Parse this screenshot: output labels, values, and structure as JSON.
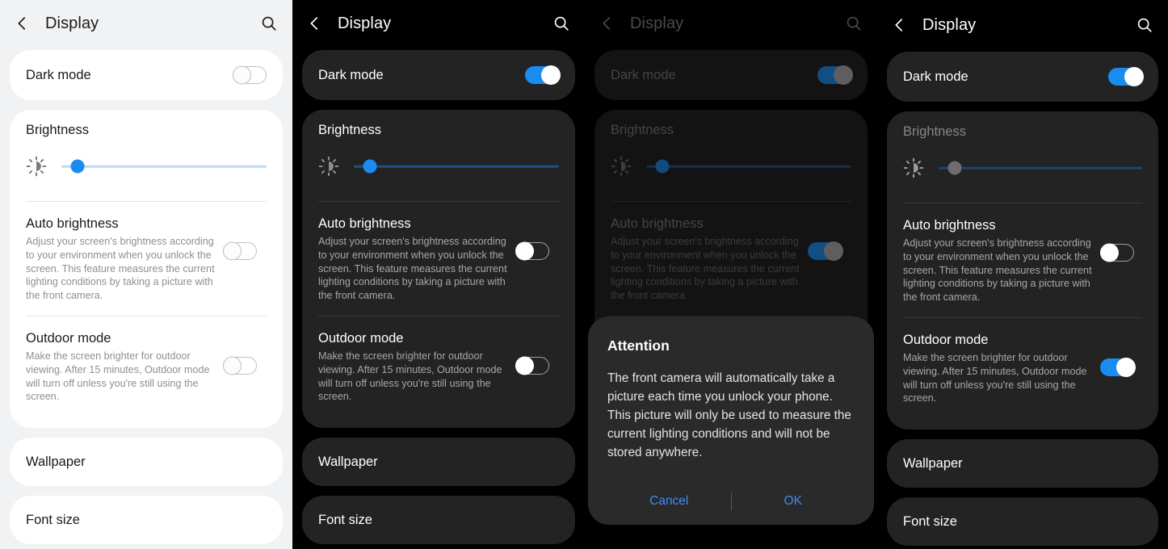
{
  "header": {
    "title": "Display",
    "back_icon": "chevron-left-icon",
    "search_icon": "search-icon"
  },
  "settings": {
    "dark_mode_label": "Dark mode",
    "brightness_label": "Brightness",
    "brightness_icon": "brightness-sun-icon",
    "auto_brightness_title": "Auto brightness",
    "auto_brightness_desc": "Adjust your screen's brightness according to your environment when you unlock the screen. This feature measures the current lighting conditions by taking a picture with the front camera.",
    "outdoor_mode_title": "Outdoor mode",
    "outdoor_mode_desc": "Make the screen brighter for outdoor viewing. After 15 minutes, Outdoor mode will turn off unless you're still using the screen.",
    "wallpaper_label": "Wallpaper",
    "font_size_label": "Font size"
  },
  "dialog": {
    "title": "Attention",
    "body": "The front camera will automatically take a picture each time you unlock your phone. This picture will only be used to measure the current lighting conditions and will not be stored anywhere.",
    "cancel_label": "Cancel",
    "ok_label": "OK"
  },
  "panels": [
    {
      "theme": "light",
      "dark_mode_on": false,
      "brightness_value": 8,
      "brightness_enabled": true,
      "auto_brightness_on": false,
      "outdoor_mode_on": false,
      "dimmed": false,
      "dialog_visible": false
    },
    {
      "theme": "dark",
      "dark_mode_on": true,
      "brightness_value": 8,
      "brightness_enabled": true,
      "auto_brightness_on": false,
      "outdoor_mode_on": false,
      "dimmed": false,
      "dialog_visible": false
    },
    {
      "theme": "dark",
      "dark_mode_on": true,
      "brightness_value": 8,
      "brightness_enabled": true,
      "auto_brightness_on": true,
      "outdoor_mode_on": false,
      "dimmed": true,
      "dialog_visible": true
    },
    {
      "theme": "dark",
      "dark_mode_on": true,
      "brightness_value": 8,
      "brightness_enabled": false,
      "auto_brightness_on": false,
      "outdoor_mode_on": true,
      "dimmed": false,
      "dialog_visible": false
    }
  ],
  "colors": {
    "accent_blue": "#1a8cf0",
    "dialog_link_blue": "#3f8cf4",
    "light_bg": "#f1f2f3",
    "dark_bg": "#000000",
    "dark_card": "#232323"
  }
}
